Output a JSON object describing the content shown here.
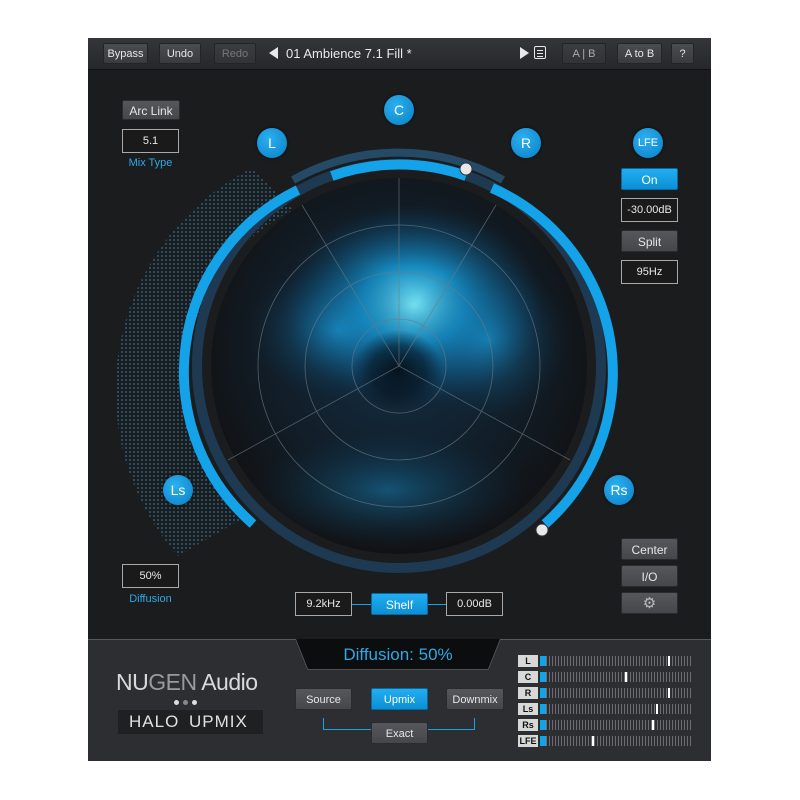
{
  "toolbar": {
    "bypass": "Bypass",
    "undo": "Undo",
    "redo": "Redo",
    "preset_name": "01 Ambience 7.1 Fill *",
    "ab": "A | B",
    "atob": "A to B",
    "help": "?"
  },
  "left_panel": {
    "arc_link": "Arc Link",
    "mix_type_value": "5.1",
    "mix_type_label": "Mix Type",
    "diffusion_value": "50%",
    "diffusion_label": "Diffusion"
  },
  "speakers": {
    "c": "C",
    "l": "L",
    "r": "R",
    "ls": "Ls",
    "rs": "Rs",
    "lfe": "LFE"
  },
  "lfe_panel": {
    "on": "On",
    "gain": "-30.00dB",
    "split": "Split",
    "freq": "95Hz"
  },
  "right_buttons": {
    "center": "Center",
    "io": "I/O"
  },
  "filter": {
    "freq": "9.2kHz",
    "mode": "Shelf",
    "gain": "0.00dB"
  },
  "status": {
    "display": "Diffusion: 50%"
  },
  "brand": {
    "nu": "NU",
    "gen": "GEN",
    "audio": " Audio",
    "product_halo": "HALO",
    "product_upmix": "UPMIX"
  },
  "mode": {
    "source": "Source",
    "upmix": "Upmix",
    "downmix": "Downmix",
    "exact": "Exact"
  },
  "meters": [
    {
      "label": "L",
      "level": 0.04,
      "peak": 0.84
    },
    {
      "label": "C",
      "level": 0.04,
      "peak": 0.56
    },
    {
      "label": "R",
      "level": 0.04,
      "peak": 0.84
    },
    {
      "label": "Ls",
      "level": 0.04,
      "peak": 0.76
    },
    {
      "label": "Rs",
      "level": 0.04,
      "peak": 0.74
    },
    {
      "label": "LFE",
      "level": 0.04,
      "peak": 0.34
    }
  ],
  "colors": {
    "accent": "#14a2e8",
    "background": "#1b1c1e"
  }
}
